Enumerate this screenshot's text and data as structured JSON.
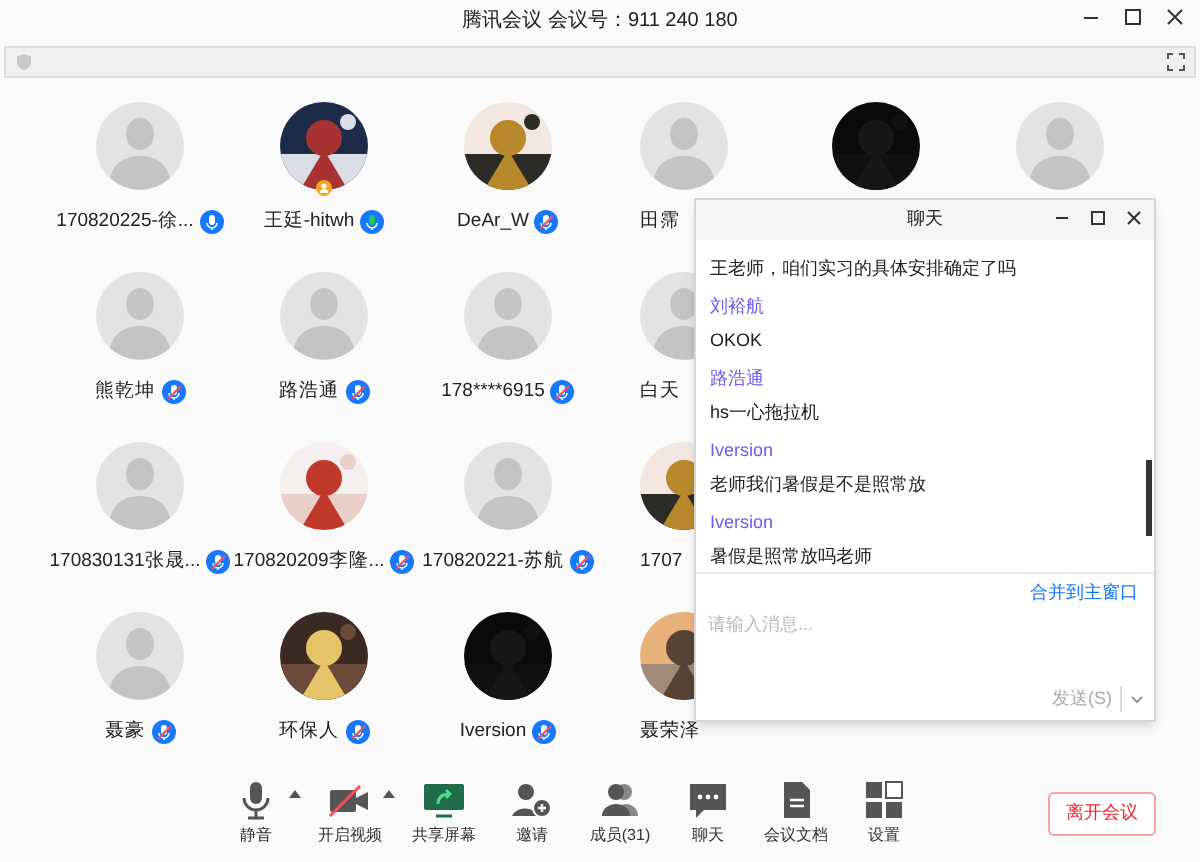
{
  "window": {
    "title": "腾讯会议 会议号：911 240 180"
  },
  "grid": [
    [
      {
        "name": "170820225-徐...",
        "kind": "default",
        "muted": false,
        "speaking": false,
        "host": false
      },
      {
        "name": "王廷-hitwh",
        "kind": "picture",
        "muted": false,
        "speaking": true,
        "host": true
      },
      {
        "name": "DeAr_W",
        "kind": "picture",
        "muted": true,
        "speaking": false,
        "host": false
      },
      {
        "name": "田霈",
        "kind": "default",
        "host": false
      },
      {
        "kind": "picture",
        "host": false
      },
      {
        "kind": "default",
        "host": false
      }
    ],
    [
      {
        "name": "熊乾坤",
        "kind": "default",
        "muted": true,
        "speaking": false,
        "host": false
      },
      {
        "name": "路浩通",
        "kind": "default",
        "muted": true,
        "speaking": false,
        "host": false
      },
      {
        "name": "178****6915",
        "kind": "default",
        "muted": true,
        "speaking": false,
        "host": false
      },
      {
        "name": "白天",
        "kind": "default",
        "host": false
      }
    ],
    [
      {
        "name": "170830131张晟...",
        "kind": "default",
        "muted": true,
        "speaking": false,
        "host": false
      },
      {
        "name": "170820209李隆...",
        "kind": "picture",
        "muted": true,
        "speaking": false,
        "host": false
      },
      {
        "name": "170820221-苏航",
        "kind": "default",
        "muted": true,
        "speaking": false,
        "host": false
      },
      {
        "name": "1707",
        "kind": "picture",
        "host": false
      }
    ],
    [
      {
        "name": "聂豪",
        "kind": "default",
        "muted": true,
        "speaking": false,
        "host": false
      },
      {
        "name": "环保人",
        "kind": "picture",
        "muted": true,
        "speaking": false,
        "host": false
      },
      {
        "name": "Iversion",
        "kind": "picture",
        "muted": true,
        "speaking": false,
        "host": false
      },
      {
        "name": "聂荣泽",
        "kind": "picture",
        "host": false
      }
    ]
  ],
  "chat": {
    "title": "聊天",
    "messages": [
      {
        "kind": "text",
        "text": "王老师，咱们实习的具体安排确定了吗"
      },
      {
        "kind": "sender",
        "text": "刘裕航"
      },
      {
        "kind": "text",
        "text": "OKOK"
      },
      {
        "kind": "sender",
        "text": "路浩通"
      },
      {
        "kind": "text",
        "text": "hs一心拖拉机"
      },
      {
        "kind": "sender",
        "text": "Iversion"
      },
      {
        "kind": "text",
        "text": "老师我们暑假是不是照常放"
      },
      {
        "kind": "sender",
        "text": "Iversion"
      },
      {
        "kind": "text",
        "text": "暑假是照常放吗老师"
      }
    ],
    "merge_link": "合并到主窗口",
    "input": {
      "placeholder": "请输入消息..."
    },
    "send_button": {
      "label": "发送(S)",
      "disabled": true
    }
  },
  "toolbar": [
    {
      "kind": "mic",
      "label": "静音",
      "caret": true
    },
    {
      "kind": "video",
      "label": "开启视频",
      "caret": true
    },
    {
      "kind": "share",
      "label": "共享屏幕",
      "caret": false
    },
    {
      "kind": "invite",
      "label": "邀请",
      "caret": false
    },
    {
      "kind": "members",
      "label": "成员(31)",
      "caret": false
    },
    {
      "kind": "chat",
      "label": "聊天",
      "caret": false
    },
    {
      "kind": "docs",
      "label": "会议文档",
      "caret": false
    },
    {
      "kind": "settings",
      "label": "设置",
      "caret": false
    }
  ],
  "leave_button": "离开会议"
}
